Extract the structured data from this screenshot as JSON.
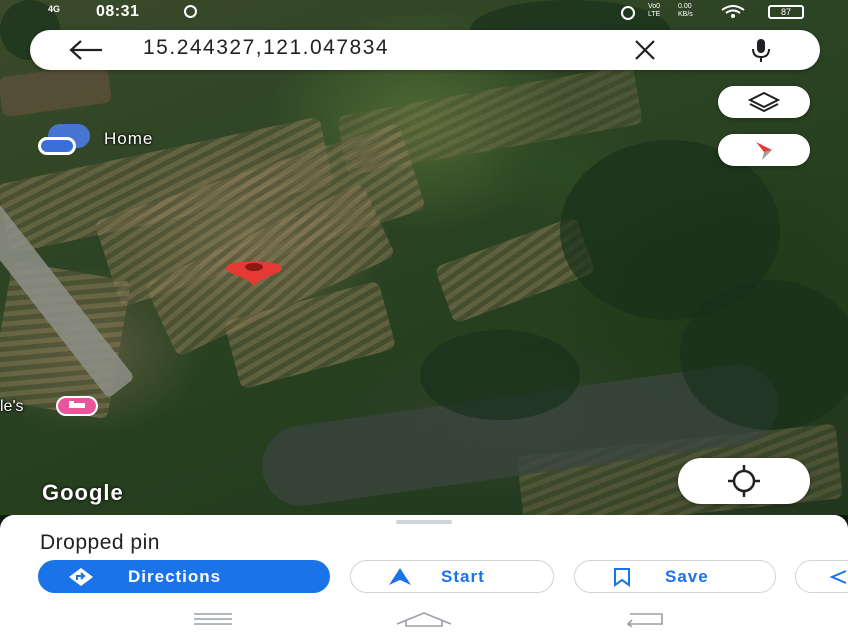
{
  "status": {
    "network": "4G",
    "time": "08:31",
    "volte": "Vo0 LTE",
    "speed": "0.00 KB/s",
    "battery": "87"
  },
  "search": {
    "query": "15.244327,121.047834"
  },
  "map": {
    "home_label": "Home",
    "poi_label": "le's",
    "logo": "Google"
  },
  "sheet": {
    "title": "Dropped pin",
    "actions": {
      "directions": "Directions",
      "start": "Start",
      "save": "Save"
    }
  },
  "colors": {
    "accent": "#1a73e8",
    "pin": "#e53935",
    "poi": "#e9559a"
  }
}
